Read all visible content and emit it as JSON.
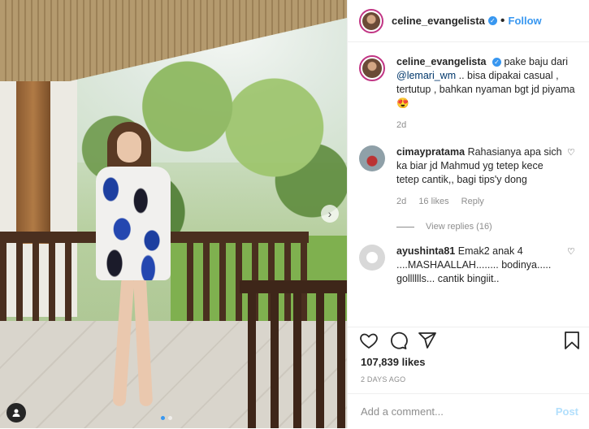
{
  "header": {
    "username": "celine_evangelista",
    "follow_label": "Follow",
    "dot": "•"
  },
  "caption": {
    "username": "celine_evangelista",
    "text_before": "pake baju dari ",
    "mention": "@lemari_wm",
    "text_after": " .. bisa dipakai casual , tertutup , bahkan nyaman bgt jd piyama 😍",
    "age": "2d"
  },
  "comments": [
    {
      "username": "cimaypratama",
      "text": "Rahasianya apa sich ka biar jd Mahmud yg tetep kece tetep cantik,, bagi tips'y dong",
      "age": "2d",
      "likes": "16 likes",
      "reply": "Reply",
      "view_replies": "View replies (16)"
    },
    {
      "username": "ayushinta81",
      "text": "Emak2 anak 4 ....MASHAALLAH........ bodinya..... golllllls... cantik bingiit.."
    }
  ],
  "actions": {
    "like_icon": "heart-icon",
    "comment_icon": "comment-icon",
    "share_icon": "share-icon",
    "save_icon": "bookmark-icon"
  },
  "likes": "107,839 likes",
  "date": "2 DAYS AGO",
  "add_comment": {
    "placeholder": "Add a comment...",
    "post_label": "Post"
  },
  "colors": {
    "accent": "#3897f0",
    "text": "#262626",
    "muted": "#8e8e8e"
  }
}
